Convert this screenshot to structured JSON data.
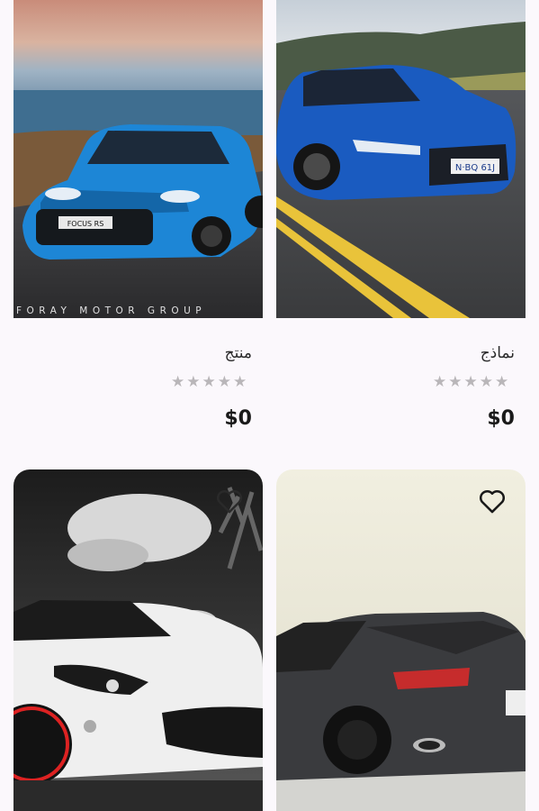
{
  "products": [
    {
      "title": "منتج",
      "price": "$0",
      "rating": 0,
      "max_rating": 5,
      "image_watermark": "FORAY MOTOR GROUP",
      "image_plate": "FOCUS RS"
    },
    {
      "title": "نماذج",
      "price": "$0",
      "rating": 0,
      "max_rating": 5,
      "image_plate": "N·BQ 61J"
    },
    {
      "heart_icon": "heart-outline-icon"
    },
    {
      "heart_icon": "heart-outline-icon"
    }
  ],
  "colors": {
    "background": "#fbf8fc",
    "star_empty": "#b9b6b9",
    "text": "#1a1a1a"
  }
}
